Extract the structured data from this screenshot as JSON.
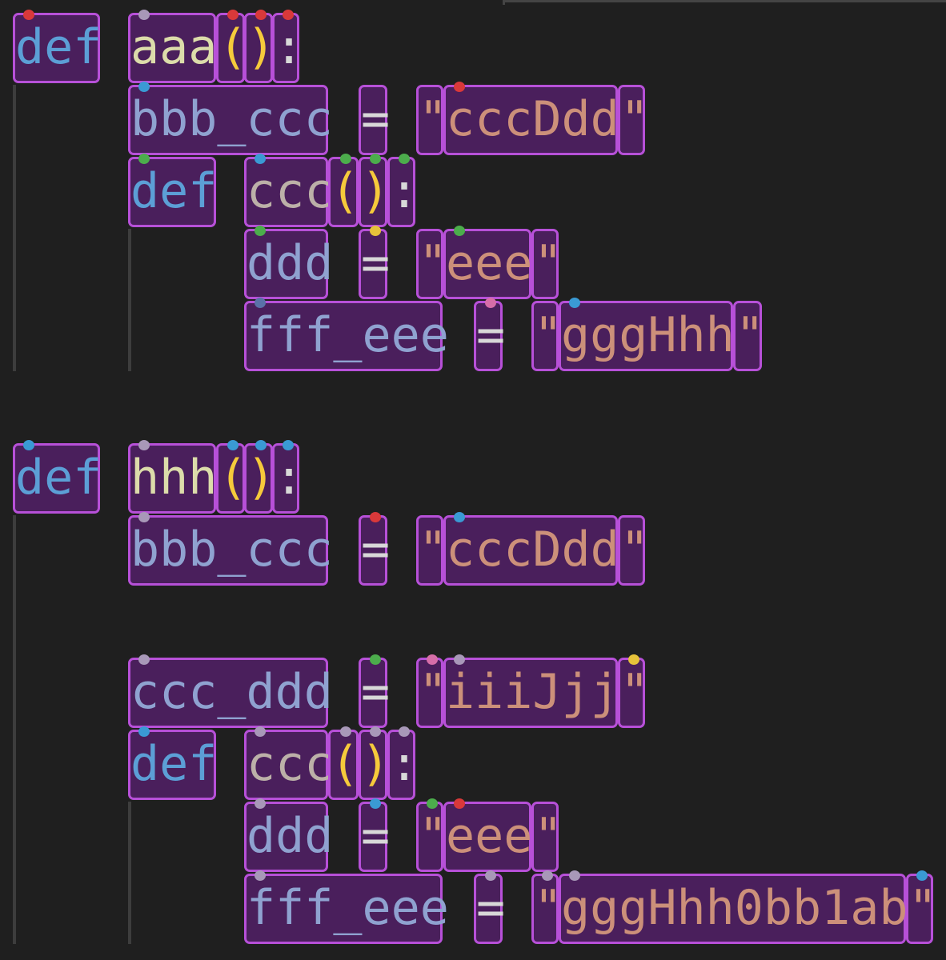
{
  "colors": {
    "keyword": "#5c9fd6",
    "function": "#dcdcaa",
    "function_inner": "#bcb0a8",
    "variable": "#8fa2d0",
    "string": "#cc907a",
    "paren": "#f6ca3b",
    "punct": "#d8d8d8",
    "dot_red": "#d9393a",
    "dot_gray": "#a898b8",
    "dot_blue": "#3a9ad4",
    "dot_green": "#4cad4c",
    "dot_yellow": "#e6c23a",
    "dot_pink": "#d66ea8",
    "dot_slate": "#5a72a8"
  },
  "code": {
    "block1": {
      "def1": {
        "text": "def",
        "dot": "red"
      },
      "aaa": {
        "text": "aaa",
        "dot": "gray"
      },
      "aaa_lp": {
        "text": "(",
        "dot": "red"
      },
      "aaa_rp": {
        "text": ")",
        "dot": "red"
      },
      "aaa_colon": {
        "text": ":",
        "dot": "red"
      },
      "l2_var": {
        "text": "bbb_ccc",
        "dot": "blue"
      },
      "l2_eq": {
        "text": "="
      },
      "l2_q1": {
        "text": "\""
      },
      "l2_str": {
        "text": "cccDdd",
        "dot": "red"
      },
      "l2_q2": {
        "text": "\""
      },
      "l3_def": {
        "text": "def",
        "dot": "green"
      },
      "l3_fn": {
        "text": "ccc",
        "dot": "blue"
      },
      "l3_lp": {
        "text": "(",
        "dot": "green"
      },
      "l3_rp": {
        "text": ")",
        "dot": "green"
      },
      "l3_colon": {
        "text": ":",
        "dot": "green"
      },
      "l4_var": {
        "text": "ddd",
        "dot": "green"
      },
      "l4_eq": {
        "text": "=",
        "dot": "yellow"
      },
      "l4_q1": {
        "text": "\""
      },
      "l4_str": {
        "text": "eee",
        "dot": "green"
      },
      "l4_q2": {
        "text": "\""
      },
      "l5_var": {
        "text": "fff_eee",
        "dot": "slate"
      },
      "l5_eq": {
        "text": "=",
        "dot": "pink"
      },
      "l5_q1": {
        "text": "\""
      },
      "l5_str": {
        "text": "gggHhh",
        "dot": "blue"
      },
      "l5_q2": {
        "text": "\""
      }
    },
    "block2": {
      "def1": {
        "text": "def",
        "dot": "blue"
      },
      "hhh": {
        "text": "hhh",
        "dot": "gray"
      },
      "hhh_lp": {
        "text": "(",
        "dot": "blue"
      },
      "hhh_rp": {
        "text": ")",
        "dot": "blue"
      },
      "hhh_colon": {
        "text": ":",
        "dot": "blue"
      },
      "l2_var": {
        "text": "bbb_ccc",
        "dot": "gray"
      },
      "l2_eq": {
        "text": "=",
        "dot": "red"
      },
      "l2_q1": {
        "text": "\""
      },
      "l2_str": {
        "text": "cccDdd",
        "dot": "blue"
      },
      "l2_q2": {
        "text": "\""
      },
      "l4_var": {
        "text": "ccc_ddd",
        "dot": "gray"
      },
      "l4_eq": {
        "text": "=",
        "dot": "green"
      },
      "l4_q1": {
        "text": "\"",
        "dot": "pink"
      },
      "l4_str": {
        "text": "iiiJjj",
        "dot": "gray"
      },
      "l4_q2": {
        "text": "\"",
        "dot": "yellow"
      },
      "l5_def": {
        "text": "def",
        "dot": "blue"
      },
      "l5_fn": {
        "text": "ccc",
        "dot": "gray"
      },
      "l5_lp": {
        "text": "(",
        "dot": "gray"
      },
      "l5_rp": {
        "text": ")",
        "dot": "gray"
      },
      "l5_colon": {
        "text": ":",
        "dot": "gray"
      },
      "l6_var": {
        "text": "ddd",
        "dot": "gray"
      },
      "l6_eq": {
        "text": "=",
        "dot": "blue"
      },
      "l6_q1": {
        "text": "\"",
        "dot": "green"
      },
      "l6_str": {
        "text": "eee",
        "dot": "red"
      },
      "l6_q2": {
        "text": "\""
      },
      "l7_var": {
        "text": "fff_eee",
        "dot": "gray"
      },
      "l7_eq": {
        "text": "=",
        "dot": "gray"
      },
      "l7_q1": {
        "text": "\"",
        "dot": "gray"
      },
      "l7_str": {
        "text": "gggHhh0bb1ab",
        "dot": "gray"
      },
      "l7_q2": {
        "text": "\"",
        "dot": "blue"
      }
    }
  }
}
